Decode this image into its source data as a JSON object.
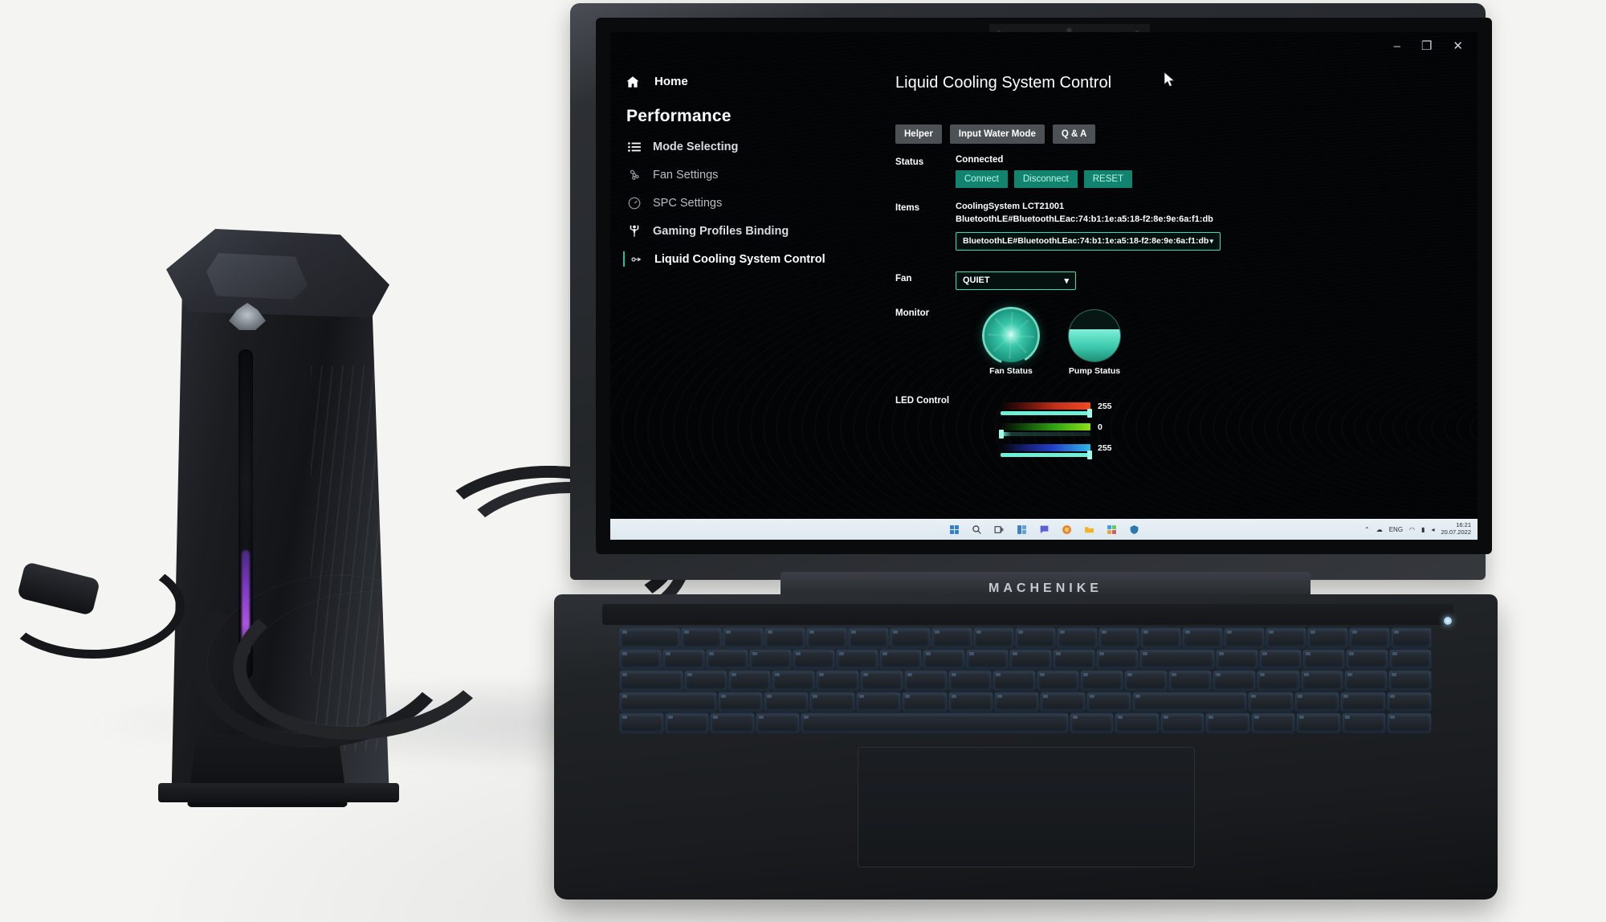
{
  "window": {
    "controls": [
      "–",
      "❐",
      "✕"
    ]
  },
  "sidebar": {
    "home": {
      "label": "Home",
      "icon": "home-icon"
    },
    "section_title": "Performance",
    "items": [
      {
        "label": "Mode Selecting",
        "icon": "list-icon",
        "active": false
      },
      {
        "label": "Fan Settings",
        "icon": "fan-icon",
        "active": false
      },
      {
        "label": "SPC Settings",
        "icon": "gauge-icon",
        "active": false
      },
      {
        "label": "Gaming Profiles Binding",
        "icon": "person-icon",
        "active": false
      },
      {
        "label": "Liquid Cooling System Control",
        "icon": "cooling-icon",
        "active": true
      }
    ]
  },
  "main": {
    "page_title": "Liquid Cooling System Control",
    "tabs": [
      {
        "label": "Helper"
      },
      {
        "label": "Input Water Mode"
      },
      {
        "label": "Q & A"
      }
    ],
    "status": {
      "label": "Status",
      "value": "Connected",
      "buttons": [
        {
          "label": "Connect"
        },
        {
          "label": "Disconnect"
        },
        {
          "label": "RESET"
        }
      ]
    },
    "items": {
      "label": "Items",
      "line1": "CoolingSystem LCT21001",
      "line2": "BluetoothLE#BluetoothLEac:74:b1:1e:a5:18-f2:8e:9e:6a:f1:db",
      "select_value": "BluetoothLE#BluetoothLEac:74:b1:1e:a5:18-f2:8e:9e:6a:f1:db",
      "chevron": "▾"
    },
    "fan": {
      "label": "Fan",
      "value": "QUIET",
      "chevron": "▾"
    },
    "monitor": {
      "label": "Monitor",
      "gauges": [
        {
          "label": "Fan Status",
          "name": "fan-status-gauge"
        },
        {
          "label": "Pump Status",
          "name": "pump-status-gauge"
        }
      ]
    },
    "led": {
      "label": "LED Control",
      "channels": [
        {
          "name": "red",
          "value": "255",
          "fill_pct": 100
        },
        {
          "name": "green",
          "value": "0",
          "fill_pct": 0
        },
        {
          "name": "blue",
          "value": "255",
          "fill_pct": 100
        }
      ]
    }
  },
  "taskbar": {
    "icons": [
      "start-icon",
      "search-icon",
      "taskview-icon",
      "widgets-icon",
      "chat-icon",
      "browser-icon",
      "explorer-icon",
      "store-icon",
      "shield-icon"
    ],
    "tray": {
      "chevron": "⌃",
      "onedrive": "☁",
      "language": "ENG",
      "wifi": "◠",
      "battery": "▮",
      "volume": "◂",
      "time": "16:21",
      "date": "20.07.2022"
    }
  },
  "laptop": {
    "brand": "MACHENIKE"
  },
  "colors": {
    "accent": "#2fe0b5",
    "button_green": "#11836e",
    "tab_gray": "#4c5156",
    "screen_bg": "#030405"
  }
}
